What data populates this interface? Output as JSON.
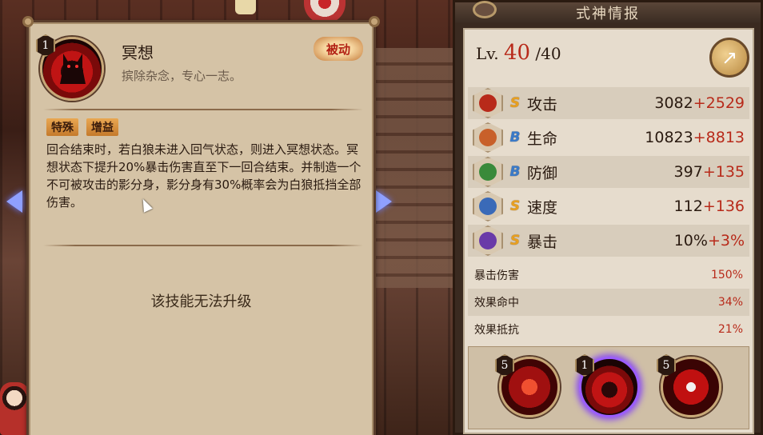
{
  "skill_panel": {
    "level": "1",
    "name": "冥想",
    "subtitle": "摈除杂念，专心一志。",
    "type_tag": "被动",
    "tags": [
      "特殊",
      "增益"
    ],
    "description": "回合结束时，若白狼未进入回气状态，则进入冥想状态。冥想状态下提升20%暴击伤害直至下一回合结束。并制造一个不可被攻击的影分身，影分身有30%概率会为白狼抵挡全部伤害。",
    "upgrade_note": "该技能无法升级"
  },
  "stats_panel": {
    "title": "式神情报",
    "level_label": "Lv.",
    "level_current": "40",
    "level_max": "/40",
    "share_icon": "share-icon",
    "stats": [
      {
        "icon": "attack-icon",
        "grade": "S",
        "name": "攻击",
        "base": "3082",
        "bonus": "+2529",
        "color": "#b82a1a"
      },
      {
        "icon": "health-icon",
        "grade": "B",
        "name": "生命",
        "base": "10823",
        "bonus": "+8813",
        "color": "#c8602a"
      },
      {
        "icon": "defense-icon",
        "grade": "B",
        "name": "防御",
        "base": "397",
        "bonus": "+135",
        "color": "#3a8a3a"
      },
      {
        "icon": "speed-icon",
        "grade": "S",
        "name": "速度",
        "base": "112",
        "bonus": "+136",
        "color": "#3a6ab8"
      },
      {
        "icon": "crit-icon",
        "grade": "S",
        "name": "暴击",
        "base": "10%",
        "bonus": "+3%",
        "color": "#6a3aa8"
      }
    ],
    "sub_stats": [
      {
        "name": "暴击伤害",
        "value": "150%"
      },
      {
        "name": "效果命中",
        "value": "34%"
      },
      {
        "name": "效果抵抗",
        "value": "21%"
      }
    ],
    "skills": [
      {
        "level": "5"
      },
      {
        "level": "1"
      },
      {
        "level": "5"
      }
    ]
  }
}
